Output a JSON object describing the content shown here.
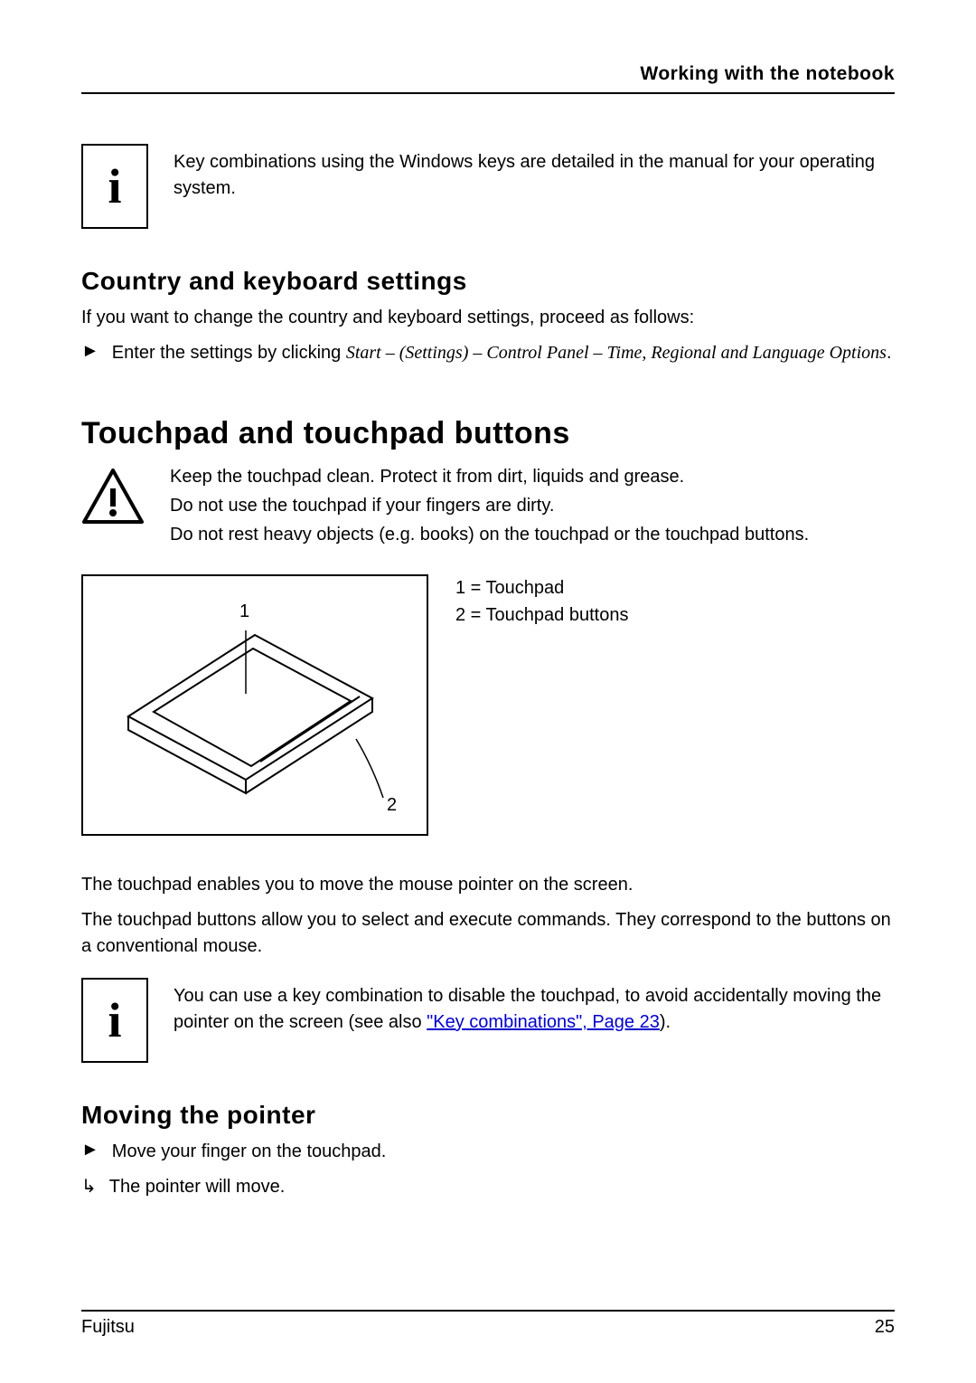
{
  "header": {
    "title": "Working with the notebook"
  },
  "info1": {
    "text": "Key combinations using the Windows keys are detailed in the manual for your operating system."
  },
  "country": {
    "heading": "Country and keyboard settings",
    "intro": "If you want to change the country and keyboard settings, proceed as follows:",
    "step_lead": "Enter the settings by clicking ",
    "step_path": "Start – (Settings) – Control Panel – Time, Regional and Language Options",
    "step_tail": "."
  },
  "touchpad": {
    "heading": "Touchpad and touchpad buttons",
    "warn1": "Keep the touchpad clean. Protect it from dirt, liquids and grease.",
    "warn2": "Do not use the touchpad if your fingers are dirty.",
    "warn3": "Do not rest heavy objects (e.g. books) on the touchpad or the touchpad buttons.",
    "legend1": "1 = Touchpad",
    "legend2": "2 = Touchpad buttons",
    "label1": "1",
    "label2": "2",
    "para1": "The touchpad enables you to move the mouse pointer on the screen.",
    "para2": "The touchpad buttons allow you to select and execute commands. They correspond to the buttons on a conventional mouse.",
    "info_lead": "You can use a key combination to disable the touchpad, to avoid accidentally moving the pointer on the screen (see also ",
    "info_link": "\"Key combinations\", Page 23",
    "info_tail": ")."
  },
  "moving": {
    "heading": "Moving the pointer",
    "step": "Move your finger on the touchpad.",
    "result": "The pointer will move."
  },
  "footer": {
    "brand": "Fujitsu",
    "page": "25"
  }
}
